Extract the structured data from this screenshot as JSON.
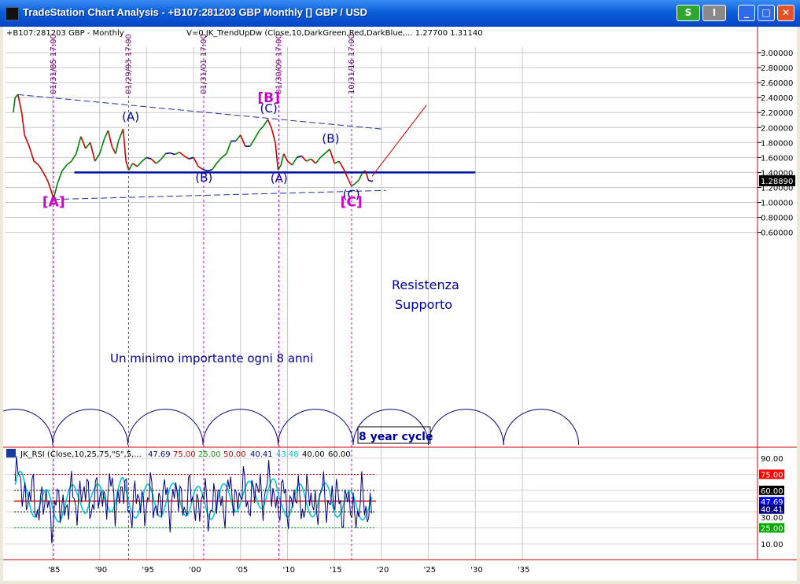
{
  "window": {
    "title": "TradeStation Chart Analysis - +B107:281203 GBP Monthly [] GBP / USD",
    "btn_s": "S",
    "btn_i": "I",
    "btn_min": "_",
    "btn_max": "□",
    "btn_close": "✕"
  },
  "header": {
    "symbol": "+B107:281203 GBP - Monthly",
    "indicator": "V=0   JK_TrendUpDw (Close,10,DarkGreen,Red,DarkBlue,...   1.27700   1.31140"
  },
  "rsi_header": {
    "name": "JK_RSI (Close,10,25,75,\"S\",5,...",
    "v1": "47.69",
    "v2": "75.00",
    "v3": "25.00",
    "v4": "50.00",
    "v5": "40.41",
    "v6": "43.48",
    "v7": "40.00",
    "v8": "60.00"
  },
  "colors": {
    "up": "#008000",
    "down": "#cc0000",
    "neutral": "#000080",
    "magenta": "#cc00cc",
    "navy": "#000099",
    "cyan": "#00d0d0"
  },
  "chart_data": [
    {
      "type": "line",
      "title": "+B107:281203 GBP - Monthly",
      "x_tick_labels": [
        "'85",
        "'90",
        "'95",
        "'00",
        "'05",
        "'10",
        "'15",
        "'20",
        "'25",
        "'30",
        "'35"
      ],
      "x_tick_years": [
        1985,
        1990,
        1995,
        2000,
        2005,
        2010,
        2015,
        2020,
        2025,
        2030,
        2035
      ],
      "y_ticks": [
        "3.00000",
        "2.80000",
        "2.60000",
        "2.40000",
        "2.20000",
        "2.00000",
        "1.80000",
        "1.60000",
        "1.40000",
        "1.20000",
        "1.00000",
        "0.80000",
        "0.60000"
      ],
      "y_tick_values": [
        3.0,
        2.8,
        2.6,
        2.4,
        2.2,
        2.0,
        1.8,
        1.6,
        1.4,
        1.2,
        1.0,
        0.8,
        0.6
      ],
      "last_price": "1.28890",
      "price": [
        [
          1980.8,
          2.2
        ],
        [
          1981.0,
          2.4
        ],
        [
          1981.3,
          2.44
        ],
        [
          1981.7,
          2.2
        ],
        [
          1982.0,
          1.9
        ],
        [
          1982.5,
          1.75
        ],
        [
          1983.0,
          1.55
        ],
        [
          1983.5,
          1.5
        ],
        [
          1984.0,
          1.4
        ],
        [
          1984.5,
          1.28
        ],
        [
          1985.1,
          1.05
        ],
        [
          1985.5,
          1.25
        ],
        [
          1986.0,
          1.42
        ],
        [
          1986.5,
          1.5
        ],
        [
          1987.0,
          1.55
        ],
        [
          1987.5,
          1.65
        ],
        [
          1988.0,
          1.88
        ],
        [
          1988.5,
          1.72
        ],
        [
          1989.0,
          1.8
        ],
        [
          1989.5,
          1.55
        ],
        [
          1990.0,
          1.65
        ],
        [
          1990.5,
          1.85
        ],
        [
          1990.9,
          1.96
        ],
        [
          1991.3,
          1.75
        ],
        [
          1991.7,
          1.65
        ],
        [
          1992.0,
          1.82
        ],
        [
          1992.5,
          1.98
        ],
        [
          1992.8,
          1.55
        ],
        [
          1993.1,
          1.43
        ],
        [
          1993.5,
          1.52
        ],
        [
          1994.0,
          1.48
        ],
        [
          1994.5,
          1.55
        ],
        [
          1995.0,
          1.6
        ],
        [
          1995.5,
          1.58
        ],
        [
          1996.0,
          1.52
        ],
        [
          1996.5,
          1.57
        ],
        [
          1997.0,
          1.65
        ],
        [
          1997.5,
          1.66
        ],
        [
          1998.0,
          1.64
        ],
        [
          1998.5,
          1.67
        ],
        [
          1999.0,
          1.62
        ],
        [
          1999.5,
          1.58
        ],
        [
          2000.0,
          1.6
        ],
        [
          2000.5,
          1.48
        ],
        [
          2001.0,
          1.44
        ],
        [
          2001.5,
          1.42
        ],
        [
          2002.0,
          1.44
        ],
        [
          2002.5,
          1.53
        ],
        [
          2003.0,
          1.6
        ],
        [
          2003.5,
          1.65
        ],
        [
          2004.0,
          1.82
        ],
        [
          2004.5,
          1.82
        ],
        [
          2005.0,
          1.9
        ],
        [
          2005.5,
          1.75
        ],
        [
          2006.0,
          1.75
        ],
        [
          2006.5,
          1.85
        ],
        [
          2007.0,
          1.96
        ],
        [
          2007.5,
          2.03
        ],
        [
          2007.9,
          2.11
        ],
        [
          2008.3,
          1.99
        ],
        [
          2008.7,
          1.8
        ],
        [
          2009.0,
          1.43
        ],
        [
          2009.3,
          1.5
        ],
        [
          2009.6,
          1.65
        ],
        [
          2010.0,
          1.55
        ],
        [
          2010.5,
          1.5
        ],
        [
          2011.0,
          1.6
        ],
        [
          2011.5,
          1.62
        ],
        [
          2012.0,
          1.55
        ],
        [
          2012.5,
          1.58
        ],
        [
          2013.0,
          1.52
        ],
        [
          2013.5,
          1.6
        ],
        [
          2014.5,
          1.71
        ],
        [
          2015.0,
          1.52
        ],
        [
          2015.5,
          1.55
        ],
        [
          2016.0,
          1.44
        ],
        [
          2016.5,
          1.3
        ],
        [
          2016.8,
          1.22
        ],
        [
          2017.2,
          1.25
        ],
        [
          2017.6,
          1.3
        ],
        [
          2018.0,
          1.4
        ],
        [
          2018.3,
          1.42
        ],
        [
          2018.6,
          1.3
        ],
        [
          2018.9,
          1.28
        ],
        [
          2019.1,
          1.289
        ]
      ],
      "projection": [
        [
          2019.0,
          1.35
        ],
        [
          2024.8,
          2.3
        ]
      ],
      "cycle_lines": [
        {
          "label": "01/31/85 17:00",
          "year": 1985.08
        },
        {
          "label": "01/29/93 17:00",
          "year": 1993.08
        },
        {
          "label": "01/31/01 17:00",
          "year": 2001.08
        },
        {
          "label": "01/30/09 17:00",
          "year": 2009.08
        },
        {
          "label": "10/31/16 17:00",
          "year": 2016.83
        }
      ],
      "cycle_period_years": 8,
      "cycle_start_year": 1977.0,
      "upper_trendline": [
        [
          1981.3,
          2.44
        ],
        [
          2020.0,
          1.98
        ]
      ],
      "lower_trendline": [
        [
          1985.1,
          1.04
        ],
        [
          2020.5,
          1.16
        ]
      ],
      "support_resistance": {
        "value": 1.4,
        "from": 1987.3,
        "to": 2030.0
      },
      "wave_labels": [
        {
          "text": "(A)",
          "year": 1993.3,
          "price": 2.09,
          "color": "navy"
        },
        {
          "text": "(B)",
          "year": 2001.1,
          "price": 1.28,
          "color": "navy"
        },
        {
          "text": "(C)",
          "year": 2008.0,
          "price": 2.2,
          "color": "navy"
        },
        {
          "text": "[B]",
          "year": 2008.0,
          "price": 2.34,
          "color": "magenta"
        },
        {
          "text": "(A)",
          "year": 2009.1,
          "price": 1.27,
          "color": "navy"
        },
        {
          "text": "(B)",
          "year": 2014.6,
          "price": 1.8,
          "color": "navy"
        },
        {
          "text": "(C)",
          "year": 2016.8,
          "price": 1.05,
          "color": "navy"
        },
        {
          "text": "[A]",
          "year": 1985.1,
          "price": 0.95,
          "color": "magenta"
        },
        {
          "text": "[C]",
          "year": 2016.8,
          "price": 0.95,
          "color": "magenta"
        }
      ],
      "annotations": {
        "resistance": "Resistenza",
        "support": "Supporto",
        "minimum_note": "Un minimo importante ogni 8 anni",
        "cycle": "8 year cycle"
      }
    },
    {
      "type": "line",
      "title": "JK_RSI (Close,10,25,75,\"S\",5,...",
      "y_ticks": [
        "90.00",
        "10.00"
      ],
      "y_tick_values": [
        90,
        10
      ],
      "levels": [
        {
          "value": 75,
          "label": "75.00",
          "color": "#cc0000"
        },
        {
          "value": 60,
          "label": "60.00",
          "color": "#000000"
        },
        {
          "value": 50,
          "label": "50.00",
          "color": "#cc0000"
        },
        {
          "value": 47.69,
          "label": "47.69",
          "color": "#0000cc"
        },
        {
          "value": 40.41,
          "label": "40.41",
          "color": "#000080"
        },
        {
          "value": 40,
          "label": "40.00",
          "color": "#000000"
        },
        {
          "value": 35,
          "label": "30.00",
          "color": "#000000"
        },
        {
          "value": 25,
          "label": "25.00",
          "color": "#009900"
        }
      ]
    }
  ]
}
